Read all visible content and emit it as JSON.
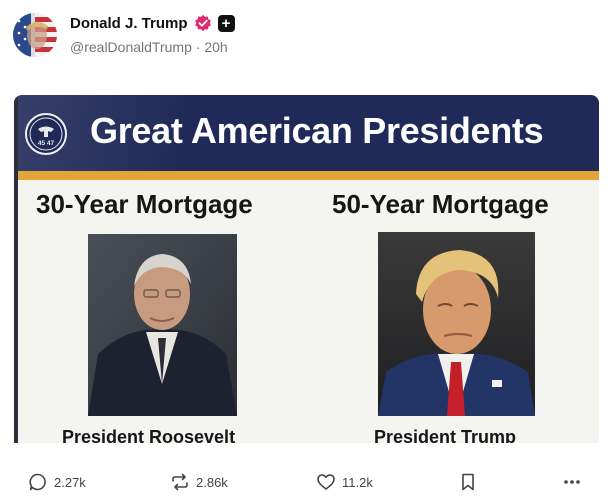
{
  "post": {
    "author_name": "Donald J. Trump",
    "handle": "@realDonaldTrump",
    "separator": "·",
    "time": "20h",
    "plus_glyph": "+"
  },
  "media": {
    "banner_title": "Great American Presidents",
    "seal_text": "45 47",
    "left_heading": "30-Year Mortgage",
    "right_heading": "50-Year Mortgage",
    "left_caption": "President Roosevelt",
    "right_caption": "President Trump",
    "colors": {
      "banner": "#1f2a58",
      "stripe": "#e2a53c",
      "verified": "#e0286a"
    }
  },
  "actions": {
    "replies": "2.27k",
    "reposts": "2.86k",
    "likes": "11.2k"
  },
  "icons": [
    "flag-avatar",
    "verified-badge-icon",
    "plus-icon",
    "eagle-seal-icon",
    "reply-icon",
    "repost-icon",
    "heart-icon",
    "bookmark-icon",
    "more-icon"
  ]
}
